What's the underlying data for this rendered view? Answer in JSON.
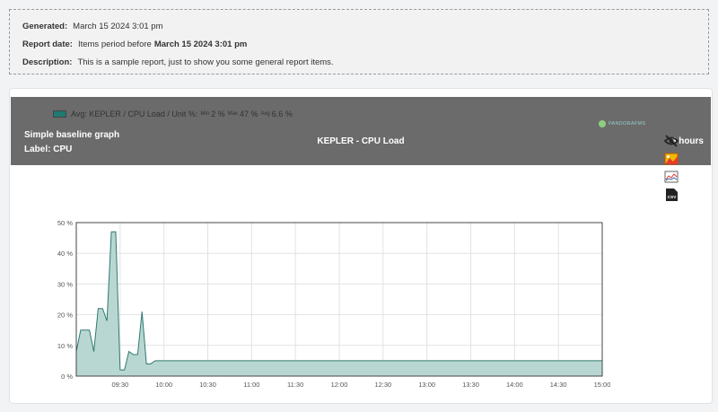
{
  "report": {
    "generated_label": "Generated:",
    "generated_value": "March 15 2024 3:01 pm",
    "report_date_label": "Report date:",
    "report_date_prefix": "Items period before",
    "report_date_value": "March 15 2024 3:01 pm",
    "description_label": "Description:",
    "description_value": "This is a sample report, just to show you some general report items."
  },
  "card": {
    "title_line1": "Simple baseline graph",
    "title_line2": "Label: CPU",
    "center_title": "KEPLER - CPU Load",
    "period": "6 hours"
  },
  "legend": {
    "name": "Avg: KEPLER / CPU Load / Unit %:",
    "min_label": "Min",
    "min_value": "2 %",
    "max_label": "Max",
    "max_value": "47 %",
    "avg_label": "Avg",
    "avg_value": "6.6 %"
  },
  "brand": {
    "text": "PANDORAFMS"
  },
  "tools": [
    "hide-icon",
    "image-export-icon",
    "graph-compare-icon",
    "csv-export-icon"
  ],
  "tool_labels": {
    "csv": "CSV"
  },
  "colors": {
    "area": "#b9d7d2",
    "line": "#2d7a70",
    "header": "#6b6b6b"
  },
  "chart_data": {
    "type": "area",
    "series": [
      {
        "name": "Avg: KEPLER / CPU Load / Unit %",
        "points": [
          [
            9.0,
            8
          ],
          [
            9.05,
            15
          ],
          [
            9.15,
            15
          ],
          [
            9.2,
            8
          ],
          [
            9.25,
            22
          ],
          [
            9.3,
            22
          ],
          [
            9.35,
            18
          ],
          [
            9.4,
            47
          ],
          [
            9.45,
            47
          ],
          [
            9.5,
            2
          ],
          [
            9.55,
            2
          ],
          [
            9.6,
            8
          ],
          [
            9.65,
            7
          ],
          [
            9.7,
            7
          ],
          [
            9.75,
            21
          ],
          [
            9.8,
            4
          ],
          [
            9.85,
            4
          ],
          [
            9.9,
            5
          ],
          [
            10.0,
            5
          ],
          [
            15.0,
            5
          ]
        ]
      }
    ],
    "x_range": [
      9.0,
      15.0
    ],
    "y_range": [
      0,
      50
    ],
    "x_ticks": [
      "09:30",
      "10:00",
      "10:30",
      "11:00",
      "11:30",
      "12:00",
      "12:30",
      "13:00",
      "13:30",
      "14:00",
      "14:30",
      "15:00"
    ],
    "x_tick_values": [
      9.5,
      10.0,
      10.5,
      11.0,
      11.5,
      12.0,
      12.5,
      13.0,
      13.5,
      14.0,
      14.5,
      15.0
    ],
    "y_ticks": [
      "0 %",
      "10 %",
      "20 %",
      "30 %",
      "40 %",
      "50 %"
    ],
    "y_tick_values": [
      0,
      10,
      20,
      30,
      40,
      50
    ],
    "grid": true
  }
}
